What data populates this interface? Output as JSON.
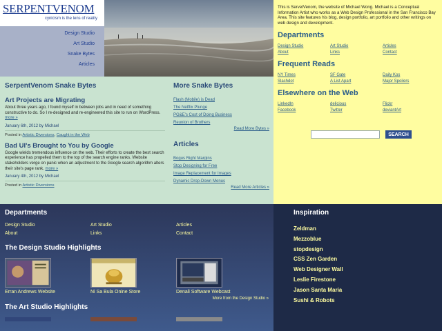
{
  "brand": {
    "logo": "SERPENTVENOM",
    "tagline": "cynicism is the lens of reality",
    "nav": [
      {
        "label": "Design Studio"
      },
      {
        "label": "Art Studio"
      },
      {
        "label": "Snake Bytes"
      },
      {
        "label": "Articles"
      }
    ]
  },
  "sidebar": {
    "intro": "This is ServetVenom, the website of Michael Wong. Michael is a Conceptual Information Artist who works as a Web Design Professional in the San Francisco Bay Area. This site features his blog, design portfolio, art portfolio and other writings on web design and development.",
    "departments_title": "Departments",
    "departments": [
      "Design Studio",
      "Art Studio",
      "Articles",
      "About",
      "Links",
      "Contact"
    ],
    "reads_title": "Frequent Reads",
    "reads": [
      "NY Times",
      "SF Gate",
      "Daily Kos",
      "Slashdot",
      "A List Apart",
      "Major Spoilers"
    ],
    "elsewhere_title": "Elsewhere on the Web",
    "elsewhere": [
      "LinkedIn",
      "delicious",
      "Flickr",
      "Facebook",
      "Twitter",
      "deviantArt"
    ],
    "search_button": "SEARCH"
  },
  "main": {
    "title": "SerpentVenom Snake Bytes",
    "posts": [
      {
        "title": "Art Projects are Migrating",
        "body": "About three years ago, I found myself in between jobs and in need of something constructive to do. So I re-designed and re-engineered this site to run on WordPress.",
        "more": "more »",
        "meta": "January 6th, 2012 by Michael",
        "posted_in": "Posted in",
        "cats": [
          "Artistic Diversions",
          "Caught in the Web"
        ]
      },
      {
        "title": "Bad UI's Brought to You by Google",
        "body": "Google wields tremendous influence on the web. Their efforts to create the best search experience has propelled them to the top of the search engine ranks. Website stakeholders verge on panic when an adjustment to the Google search algorithm alters their site's page rank.",
        "more": "more »",
        "meta": "January 4th, 2012 by Michael",
        "posted_in": "Posted in",
        "cats": [
          "Artistic Diversions"
        ]
      }
    ]
  },
  "aside": {
    "bytes_title": "More Snake Bytes",
    "bytes": [
      "Flash (Mobile) is Dead",
      "The Netflix Plunge",
      "PG&E's Cost of Doing Business",
      "Reunion of Brothers"
    ],
    "bytes_more": "Read More Bytes »",
    "articles_title": "Articles",
    "articles": [
      "Bogus Right Margins",
      "Stop Designing for Free",
      "Image Replacement for Images",
      "Dynamic Drop-Down Menus"
    ],
    "articles_more": "Read More Articles »"
  },
  "footer": {
    "departments_title": "Departments",
    "departments": [
      "Design Studio",
      "Art Studio",
      "Articles",
      "About",
      "Links",
      "Contact"
    ],
    "ds_title": "The Design Studio Highlights",
    "ds_items": [
      "Erran Andrews Website",
      "Ni Sa Bula Onine Store",
      "Denali Software Webcast"
    ],
    "ds_more": "More from the Design Studio »",
    "as_title": "The Art Studio Highlights",
    "inspiration_title": "Inspiration",
    "inspiration": [
      "Zeldman",
      "Mezzoblue",
      "stopdesign",
      "CSS Zen Garden",
      "Web Designer Wall",
      "Leslie Firestone",
      "Jason Santa Maria",
      "Sushi & Robots"
    ]
  }
}
